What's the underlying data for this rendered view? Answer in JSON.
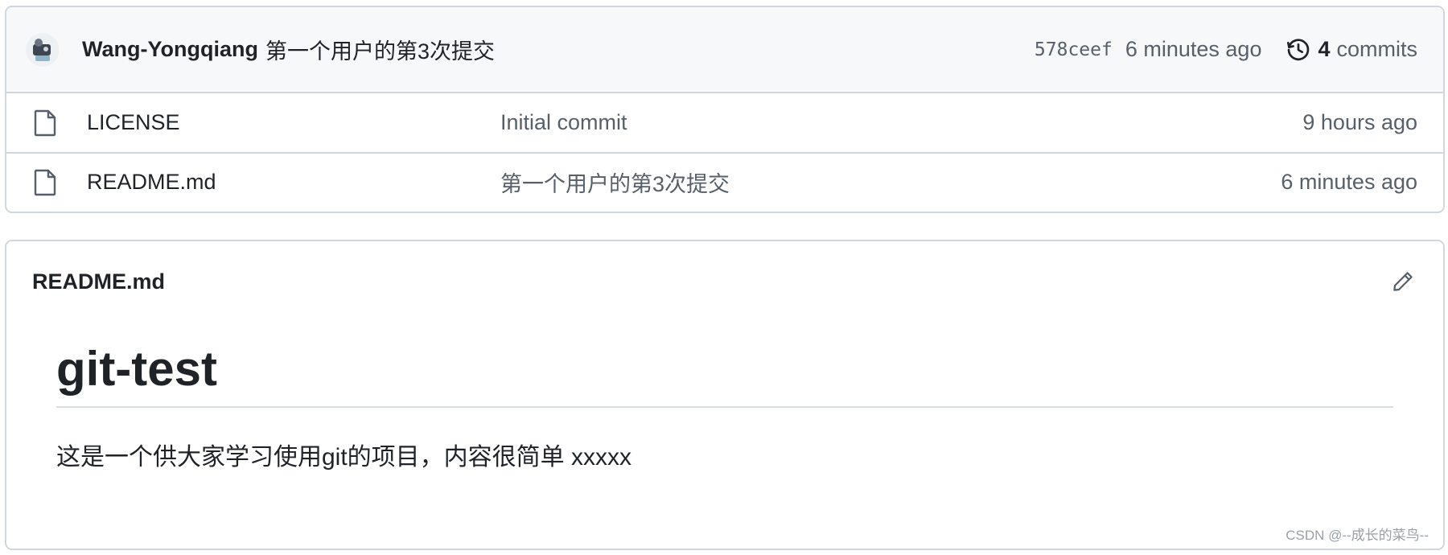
{
  "latest_commit": {
    "author": "Wang-Yongqiang",
    "message": "第一个用户的第3次提交",
    "sha": "578ceef",
    "age": "6 minutes ago",
    "commit_count": "4",
    "commits_label": "commits",
    "avatar_icon": "user-avatar",
    "history_icon": "history-icon"
  },
  "files": [
    {
      "name": "LICENSE",
      "commit_message": "Initial commit",
      "age": "9 hours ago",
      "icon": "file-icon"
    },
    {
      "name": "README.md",
      "commit_message": "第一个用户的第3次提交",
      "age": "6 minutes ago",
      "icon": "file-icon"
    }
  ],
  "readme": {
    "filename": "README.md",
    "heading": "git-test",
    "paragraph": "这是一个供大家学习使用git的项目，内容很简单 xxxxx",
    "edit_icon": "pencil-icon"
  },
  "watermark": "CSDN @--成长的菜鸟--",
  "colors": {
    "border": "#d0d7de",
    "header_bg": "#f6f8fa",
    "muted_text": "#57606a",
    "primary_text": "#1f2328"
  }
}
